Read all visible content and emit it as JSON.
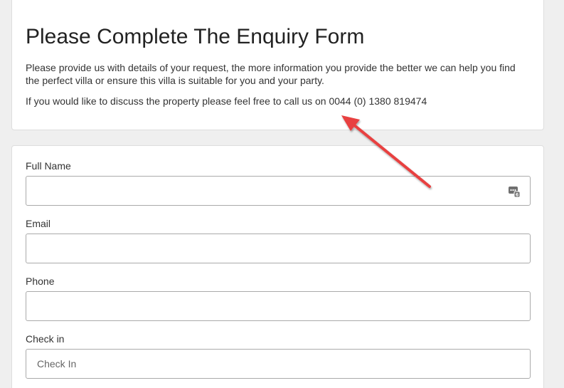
{
  "intro": {
    "title": "Please Complete The Enquiry Form",
    "description": "Please provide us with details of your request, the more information you provide the better we can help you find the perfect villa or ensure this villa is suitable for you and your party.",
    "call_text": "If you would like to discuss the property please feel free to call us on 0044 (0) 1380 819474"
  },
  "form": {
    "full_name": {
      "label": "Full Name",
      "value": "",
      "placeholder": ""
    },
    "email": {
      "label": "Email",
      "value": "",
      "placeholder": ""
    },
    "phone": {
      "label": "Phone",
      "value": "",
      "placeholder": ""
    },
    "check_in": {
      "label": "Check in",
      "value": "",
      "placeholder": "Check In"
    }
  },
  "icons": {
    "autofill": "password-manager-icon",
    "annotation": "red-arrow"
  },
  "colors": {
    "arrow": "#e8403f",
    "background": "#efefef",
    "card": "#ffffff"
  }
}
